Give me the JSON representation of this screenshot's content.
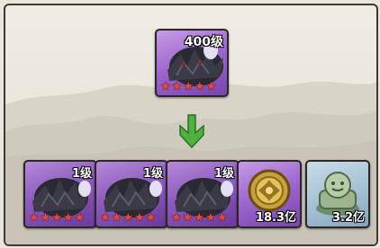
{
  "result_card": {
    "level_text": "400级",
    "stars": 5,
    "icon": "dark-spiked-beast-portrait"
  },
  "arrow_icon": "green-down-arrow",
  "materials": [
    {
      "kind": "unit",
      "level_text": "1级",
      "stars": 5,
      "icon": "dark-spiked-beast-portrait"
    },
    {
      "kind": "unit",
      "level_text": "1级",
      "stars": 5,
      "icon": "dark-spiked-beast-portrait"
    },
    {
      "kind": "unit",
      "level_text": "1级",
      "stars": 5,
      "icon": "dark-spiked-beast-portrait"
    },
    {
      "kind": "currency",
      "amount_text": "18.3亿",
      "icon": "gold-coin-icon"
    },
    {
      "kind": "currency",
      "amount_text": "3.2亿",
      "icon": "jade-seal-icon"
    }
  ],
  "colors": {
    "card_purple": "#8e5cc0",
    "card_blue": "#a7c3d6",
    "star_red": "#e84a3a",
    "arrow_green": "#4db23b",
    "frame_dark": "#3b3a36"
  }
}
